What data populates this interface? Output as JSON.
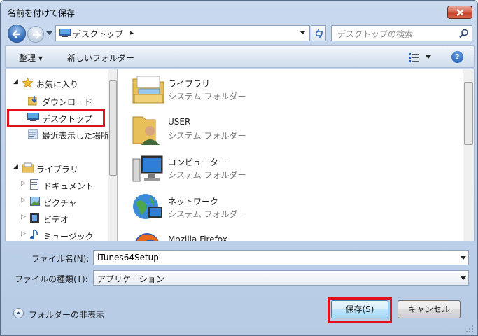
{
  "window": {
    "title": "名前を付けて保存"
  },
  "address": {
    "location": "デスクトップ",
    "chevron": "▸"
  },
  "search": {
    "placeholder": "デスクトップの検索"
  },
  "toolbar": {
    "organize": "整理 ▾",
    "new_folder": "新しいフォルダー",
    "help": "?"
  },
  "nav": {
    "favorites": "お気に入り",
    "downloads": "ダウンロード",
    "desktop": "デスクトップ",
    "recent": "最近表示した場所",
    "libraries": "ライブラリ",
    "documents": "ドキュメント",
    "pictures": "ピクチャ",
    "videos": "ビデオ",
    "music": "ミュージック"
  },
  "files": [
    {
      "name": "ライブラリ",
      "type": "システム フォルダー",
      "icon": "library-folder-icon"
    },
    {
      "name": "USER",
      "type": "システム フォルダー",
      "icon": "user-folder-icon"
    },
    {
      "name": "コンピューター",
      "type": "システム フォルダー",
      "icon": "computer-icon"
    },
    {
      "name": "ネットワーク",
      "type": "システム フォルダー",
      "icon": "network-icon"
    },
    {
      "name": "Mozilla Firefox",
      "type": "",
      "icon": "firefox-icon"
    }
  ],
  "form": {
    "filename_label": "ファイル名(N):",
    "filename_value": "iTunes64Setup",
    "filetype_label": "ファイルの種類(T):",
    "filetype_value": "アプリケーション"
  },
  "footer": {
    "hide_folders": "フォルダーの非表示",
    "save": "保存(S)",
    "cancel": "キャンセル"
  },
  "colors": {
    "highlight_outline": "#e0101c",
    "frame": "#b7cbe5"
  }
}
